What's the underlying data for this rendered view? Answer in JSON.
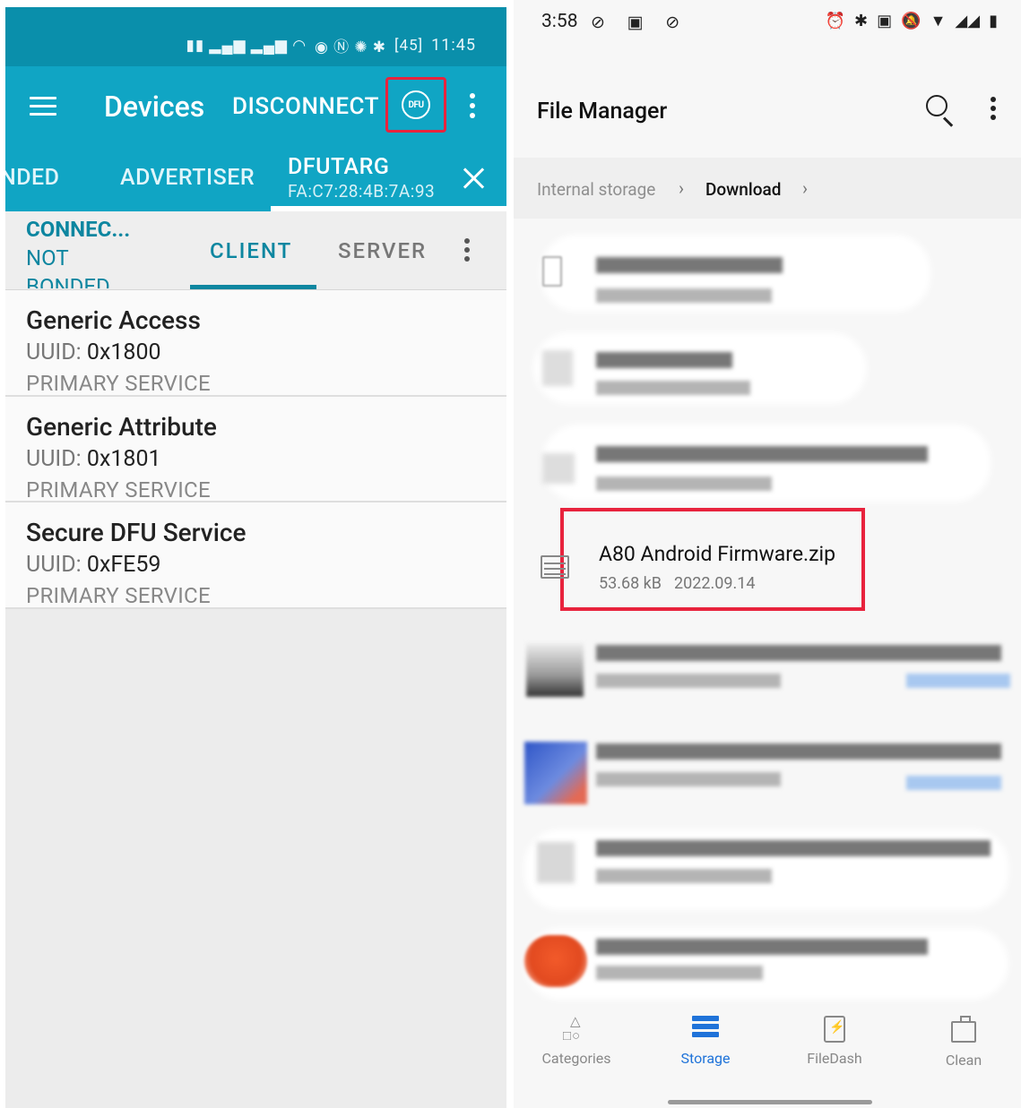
{
  "left": {
    "statusbar": {
      "time": "11:45",
      "battery": "45"
    },
    "appbar": {
      "title": "Devices",
      "disconnect_label": "DISCONNECT",
      "dfu_label": "DFU"
    },
    "device_tabs": [
      {
        "label": "NDED"
      },
      {
        "label": "ADVERTISER"
      },
      {
        "label": "DFUTARG",
        "address": "FA:C7:28:4B:7A:93",
        "active": true
      }
    ],
    "connection": {
      "status": "CONNEC...",
      "bond_line1": "NOT",
      "bond_line2": "BONDED"
    },
    "sub_tabs": {
      "client": "CLIENT",
      "server": "SERVER"
    },
    "services": [
      {
        "name": "Generic Access",
        "uuid_label": "UUID:",
        "uuid": "0x1800",
        "type": "PRIMARY SERVICE"
      },
      {
        "name": "Generic Attribute",
        "uuid_label": "UUID:",
        "uuid": "0x1801",
        "type": "PRIMARY SERVICE"
      },
      {
        "name": "Secure DFU Service",
        "uuid_label": "UUID:",
        "uuid": "0xFE59",
        "type": "PRIMARY SERVICE"
      }
    ],
    "colors": {
      "primary": "#10a5c4",
      "primary_dark": "#0a8fab",
      "accent_text": "#0d86a0",
      "highlight": "#e8233d"
    }
  },
  "right": {
    "statusbar": {
      "time": "3:58"
    },
    "appbar": {
      "title": "File Manager"
    },
    "breadcrumb": {
      "root": "Internal storage",
      "current": "Download"
    },
    "highlighted_file": {
      "name": "A80 Android Firmware.zip",
      "size": "53.68 kB",
      "date": "2022.09.14"
    },
    "bottom_nav": [
      {
        "label": "Categories",
        "icon": "categories-icon"
      },
      {
        "label": "Storage",
        "icon": "storage-icon",
        "active": true
      },
      {
        "label": "FileDash",
        "icon": "filedash-icon"
      },
      {
        "label": "Clean",
        "icon": "clean-icon"
      }
    ],
    "colors": {
      "active_nav": "#1f73d9",
      "highlight": "#e8233d"
    }
  }
}
